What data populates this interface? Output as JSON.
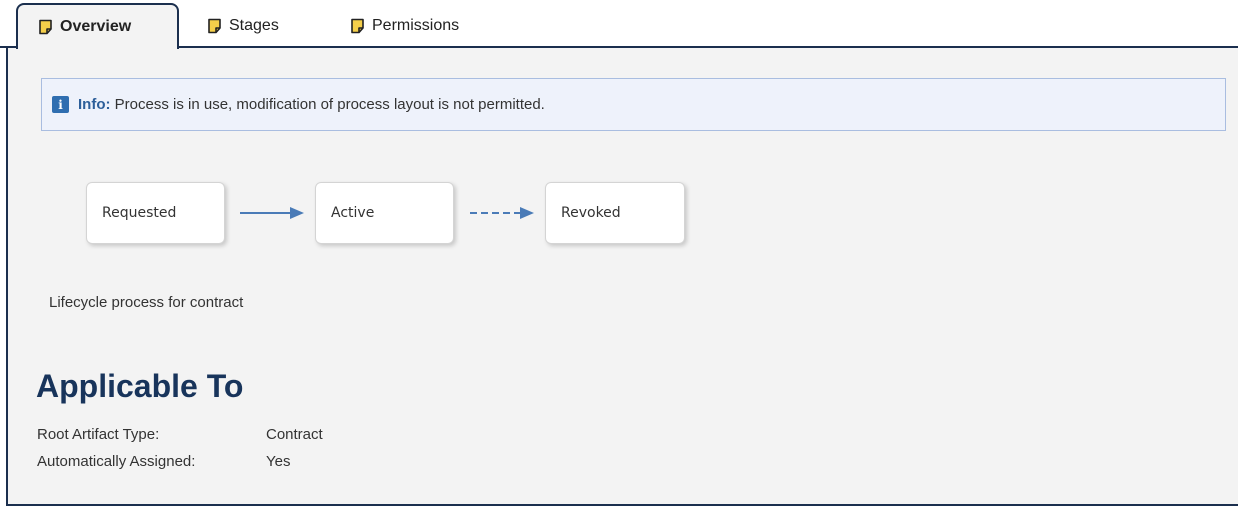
{
  "tabs": [
    {
      "label": "Overview",
      "icon": "document-icon",
      "active": true
    },
    {
      "label": "Stages",
      "icon": "document-icon",
      "active": false
    },
    {
      "label": "Permissions",
      "icon": "document-icon",
      "active": false
    }
  ],
  "info": {
    "icon": "info-icon",
    "prefix": "Info:",
    "message": "Process is in use, modification of process layout is not permitted."
  },
  "diagram": {
    "stages": [
      "Requested",
      "Active",
      "Revoked"
    ],
    "transitions": [
      {
        "from": "Requested",
        "to": "Active",
        "style": "solid"
      },
      {
        "from": "Active",
        "to": "Revoked",
        "style": "dashed"
      }
    ],
    "arrow_color": "#4a7bb7"
  },
  "description": "Lifecycle process for contract",
  "applicable": {
    "heading": "Applicable To",
    "rows": [
      {
        "label": "Root Artifact Type:",
        "value": "Contract"
      },
      {
        "label": "Automatically Assigned:",
        "value": "Yes"
      }
    ]
  },
  "colors": {
    "navy": "#1b2f4e",
    "heading": "#18345b",
    "info_bg": "#eef2fb",
    "info_border": "#a9bde0",
    "tab_icon": "#e8b92c"
  }
}
